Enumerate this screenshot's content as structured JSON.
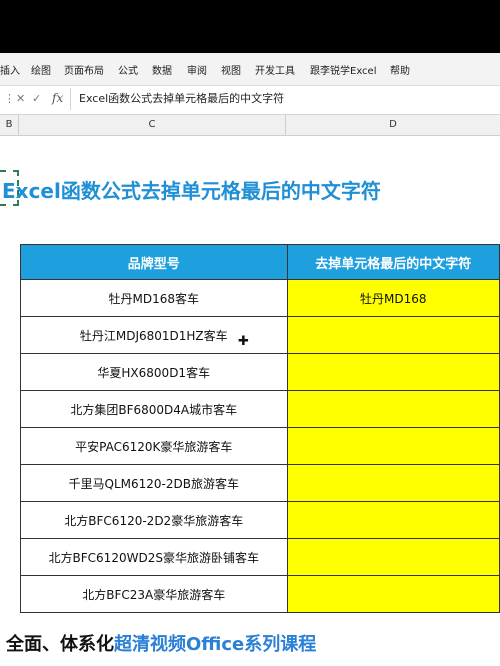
{
  "ribbon": {
    "tabs": [
      "插入",
      "绘图",
      "页面布局",
      "公式",
      "数据",
      "审阅",
      "视图",
      "开发工具",
      "跟李锐学Excel",
      "帮助"
    ]
  },
  "formula_bar": {
    "fx": "fx",
    "content": "Excel函数公式去掉单元格最后的中文字符"
  },
  "column_headers": [
    "B",
    "C",
    "D"
  ],
  "sheet_title": "Excel函数公式去掉单元格最后的中文字符",
  "table": {
    "header_b": "品牌型号",
    "header_d": "去掉单元格最后的中文字符",
    "rows": [
      {
        "model": "牡丹MD168客车",
        "result": "牡丹MD168"
      },
      {
        "model": "牡丹江MDJ6801D1HZ客车",
        "result": ""
      },
      {
        "model": "华夏HX6800D1客车",
        "result": ""
      },
      {
        "model": "北方集团BF6800D4A城市客车",
        "result": ""
      },
      {
        "model": "平安PAC6120K豪华旅游客车",
        "result": ""
      },
      {
        "model": "千里马QLM6120-2DB旅游客车",
        "result": ""
      },
      {
        "model": "北方BFC6120-2D2豪华旅游客车",
        "result": ""
      },
      {
        "model": "北方BFC6120WD2S豪华旅游卧铺客车",
        "result": ""
      },
      {
        "model": "北方BFC23A豪华旅游客车",
        "result": ""
      }
    ]
  },
  "bottom_banner": {
    "part1": "全面、体系化",
    "part2": "超清视频Office系列课程"
  },
  "colors": {
    "header_blue": "#1ea0df",
    "result_yellow": "#ffff00",
    "title_blue": "#1f8fd6"
  }
}
